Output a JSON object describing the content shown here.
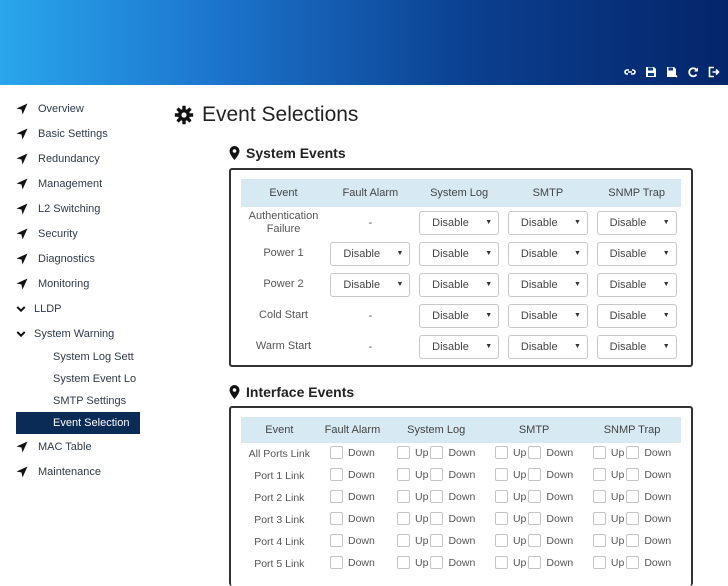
{
  "toolbar": {
    "icons": [
      "link-icon",
      "save-icon",
      "save-as-icon",
      "refresh-icon",
      "logout-icon"
    ]
  },
  "sidebar": {
    "items": [
      {
        "label": "Overview"
      },
      {
        "label": "Basic Settings"
      },
      {
        "label": "Redundancy"
      },
      {
        "label": "Management"
      },
      {
        "label": "L2 Switching"
      },
      {
        "label": "Security"
      },
      {
        "label": "Diagnostics"
      },
      {
        "label": "Monitoring"
      },
      {
        "label": "LLDP"
      },
      {
        "label": "System Warning"
      },
      {
        "label": "System Log Sett"
      },
      {
        "label": "System Event Lo"
      },
      {
        "label": "SMTP Settings"
      },
      {
        "label": "Event Selection"
      },
      {
        "label": "MAC Table"
      },
      {
        "label": "Maintenance"
      }
    ]
  },
  "page": {
    "title": "Event Selections"
  },
  "system_events": {
    "title": "System Events",
    "headers": [
      "Event",
      "Fault Alarm",
      "System Log",
      "SMTP",
      "SNMP Trap"
    ],
    "rows": [
      {
        "event": "Authentication Failure",
        "fault": "-",
        "syslog": "Disable",
        "smtp": "Disable",
        "snmp": "Disable"
      },
      {
        "event": "Power 1",
        "fault": "Disable",
        "syslog": "Disable",
        "smtp": "Disable",
        "snmp": "Disable"
      },
      {
        "event": "Power 2",
        "fault": "Disable",
        "syslog": "Disable",
        "smtp": "Disable",
        "snmp": "Disable"
      },
      {
        "event": "Cold Start",
        "fault": "-",
        "syslog": "Disable",
        "smtp": "Disable",
        "snmp": "Disable"
      },
      {
        "event": "Warm Start",
        "fault": "-",
        "syslog": "Disable",
        "smtp": "Disable",
        "snmp": "Disable"
      }
    ]
  },
  "interface_events": {
    "title": "Interface Events",
    "headers": [
      "Event",
      "Fault Alarm",
      "System Log",
      "SMTP",
      "SNMP Trap"
    ],
    "up_label": "Up",
    "down_label": "Down",
    "rows": [
      {
        "event": "All Ports Link"
      },
      {
        "event": "Port 1 Link"
      },
      {
        "event": "Port 2 Link"
      },
      {
        "event": "Port 3 Link"
      },
      {
        "event": "Port 4 Link"
      },
      {
        "event": "Port 5 Link"
      }
    ]
  }
}
